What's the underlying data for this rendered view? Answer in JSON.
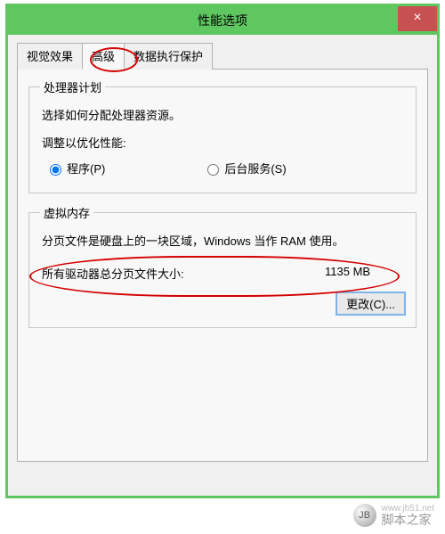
{
  "window": {
    "title": "性能选项",
    "close_label": "×"
  },
  "tabs": {
    "visual": "视觉效果",
    "advanced": "高级",
    "dep": "数据执行保护"
  },
  "scheduling": {
    "legend": "处理器计划",
    "desc": "选择如何分配处理器资源。",
    "adjust_label": "调整以优化性能:",
    "programs_label": "程序(P)",
    "background_label": "后台服务(S)"
  },
  "vm": {
    "legend": "虚拟内存",
    "desc": "分页文件是硬盘上的一块区域，Windows 当作 RAM 使用。",
    "total_label": "所有驱动器总分页文件大小:",
    "total_value": "1135 MB",
    "change_label": "更改(C)..."
  },
  "watermark": {
    "url": "www.jb51.net",
    "name": "脚本之家"
  }
}
